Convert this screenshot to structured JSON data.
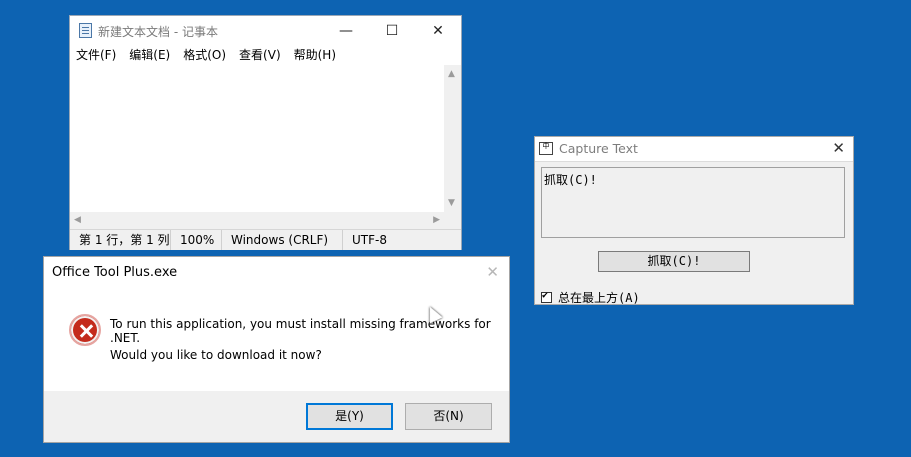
{
  "notepad": {
    "title": "新建文本文档 - 记事本",
    "menu": [
      "文件(F)",
      "编辑(E)",
      "格式(O)",
      "查看(V)",
      "帮助(H)"
    ],
    "status": {
      "position": "第 1 行，第 1 列",
      "zoom": "100%",
      "line_ending": "Windows (CRLF)",
      "encoding": "UTF-8"
    }
  },
  "capture": {
    "title": "Capture Text",
    "captured_text": "抓取(C)!",
    "button_label": "抓取(C)!",
    "topmost_label": "总在最上方(A)",
    "icon_glyph": "中"
  },
  "dialog": {
    "title": "Office Tool Plus.exe",
    "message_line1": "To run this application, you must install missing frameworks for .NET.",
    "message_line2": "Would you like to download it now?",
    "yes_label": "是(Y)",
    "no_label": "否(N)"
  },
  "colors": {
    "desktop": "#0d63b2",
    "error": "#c42b1c",
    "focus": "#0078d7"
  }
}
